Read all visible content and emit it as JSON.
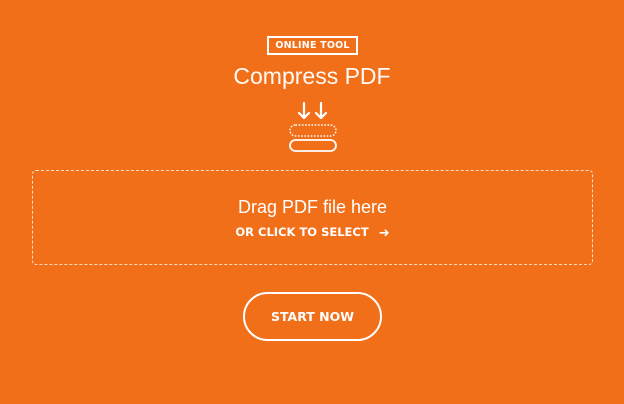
{
  "header": {
    "badge": "ONLINE TOOL",
    "title": "Compress PDF",
    "icon": "compress-icon"
  },
  "dropzone": {
    "title": "Drag PDF file here",
    "select_label": "OR CLICK TO SELECT",
    "select_icon": "arrow-right-icon"
  },
  "actions": {
    "start_label": "START NOW"
  },
  "colors": {
    "background": "#F26F1A",
    "foreground": "#FFFFFF"
  }
}
